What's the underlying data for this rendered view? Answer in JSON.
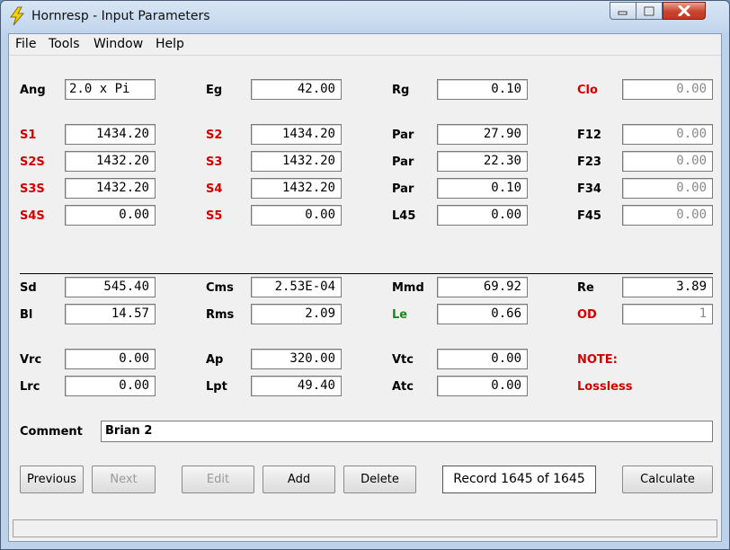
{
  "window": {
    "title": "Hornresp - Input Parameters"
  },
  "menu": {
    "file": "File",
    "tools": "Tools",
    "window": "Window",
    "help": "Help"
  },
  "row1": {
    "ang_label": "Ang",
    "ang_value": "2.0 x Pi",
    "eg_label": "Eg",
    "eg_value": "42.00",
    "rg_label": "Rg",
    "rg_value": "0.10",
    "clo_label": "Clo",
    "clo_value": "0.00"
  },
  "row2": {
    "s1_label": "S1",
    "s1_value": "1434.20",
    "s2_label": "S2",
    "s2_value": "1434.20",
    "par_label": "Par",
    "par_value": "27.90",
    "f12_label": "F12",
    "f12_value": "0.00"
  },
  "row3": {
    "s2s_label": "S2S",
    "s2s_value": "1432.20",
    "s3_label": "S3",
    "s3_value": "1432.20",
    "par_label": "Par",
    "par_value": "22.30",
    "f23_label": "F23",
    "f23_value": "0.00"
  },
  "row4": {
    "s3s_label": "S3S",
    "s3s_value": "1432.20",
    "s4_label": "S4",
    "s4_value": "1432.20",
    "par_label": "Par",
    "par_value": "0.10",
    "f34_label": "F34",
    "f34_value": "0.00"
  },
  "row5": {
    "s4s_label": "S4S",
    "s4s_value": "0.00",
    "s5_label": "S5",
    "s5_value": "0.00",
    "l45_label": "L45",
    "l45_value": "0.00",
    "f45_label": "F45",
    "f45_value": "0.00"
  },
  "row6": {
    "sd_label": "Sd",
    "sd_value": "545.40",
    "cms_label": "Cms",
    "cms_value": "2.53E-04",
    "mmd_label": "Mmd",
    "mmd_value": "69.92",
    "re_label": "Re",
    "re_value": "3.89"
  },
  "row7": {
    "bl_label": "Bl",
    "bl_value": "14.57",
    "rms_label": "Rms",
    "rms_value": "2.09",
    "le_label": "Le",
    "le_value": "0.66",
    "od_label": "OD",
    "od_value": "1"
  },
  "row8": {
    "vrc_label": "Vrc",
    "vrc_value": "0.00",
    "ap_label": "Ap",
    "ap_value": "320.00",
    "vtc_label": "Vtc",
    "vtc_value": "0.00",
    "note_label": "NOTE:"
  },
  "row9": {
    "lrc_label": "Lrc",
    "lrc_value": "0.00",
    "lpt_label": "Lpt",
    "lpt_value": "49.40",
    "atc_label": "Atc",
    "atc_value": "0.00",
    "lossless_label": "Lossless"
  },
  "comment": {
    "label": "Comment",
    "value": "Brian 2"
  },
  "buttons": {
    "previous": "Previous",
    "next": "Next",
    "edit": "Edit",
    "add": "Add",
    "delete": "Delete",
    "calculate": "Calculate"
  },
  "record": "Record 1645 of 1645",
  "colors": {
    "red_label": "#d40000",
    "green_label": "#1a8a1a"
  },
  "icons": {
    "app": "lightning-icon",
    "minimize": "minimize-icon",
    "maximize": "maximize-icon",
    "close": "close-icon"
  }
}
